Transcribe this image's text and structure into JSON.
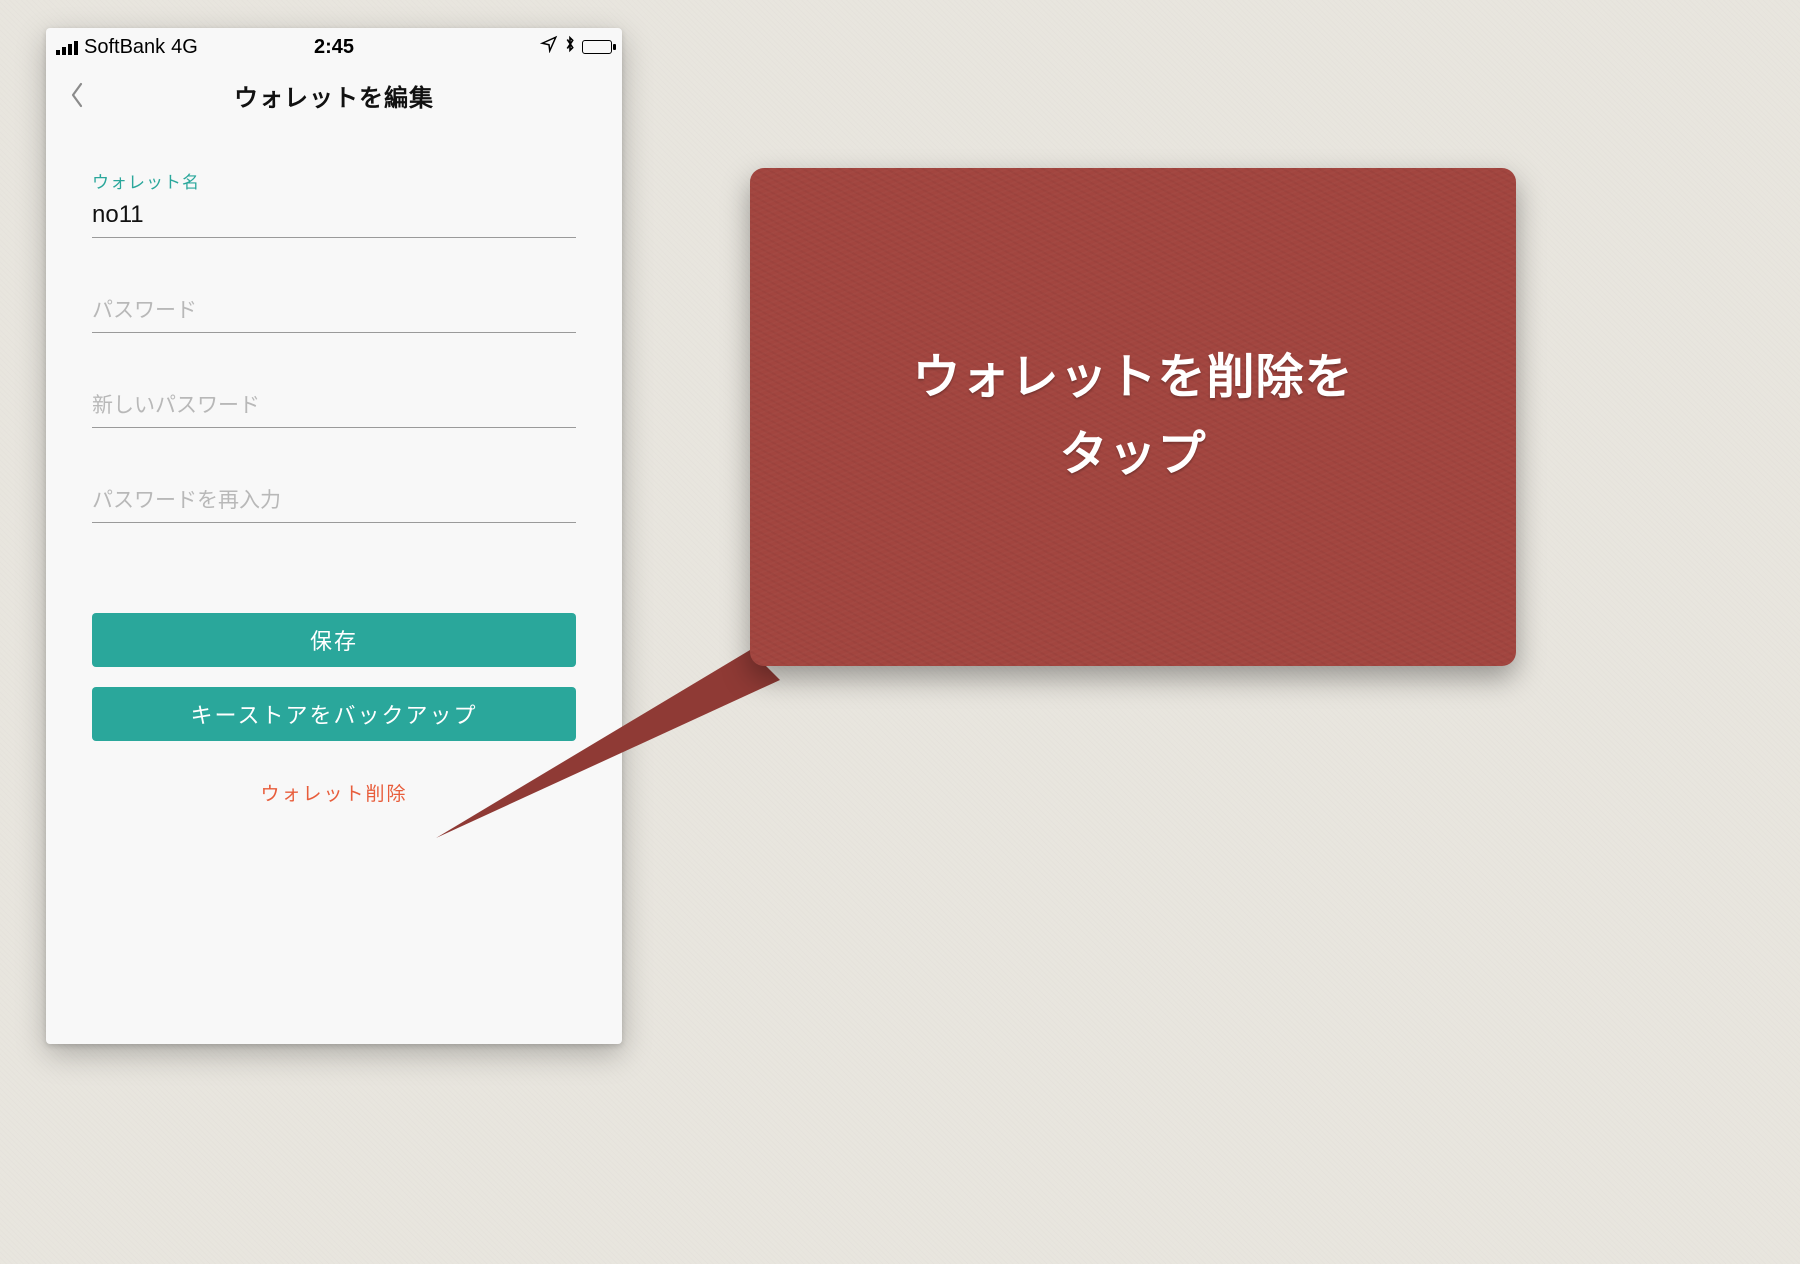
{
  "status": {
    "carrier": "SoftBank",
    "network": "4G",
    "time": "2:45"
  },
  "nav": {
    "title": "ウォレットを編集"
  },
  "fields": {
    "name_label": "ウォレット名",
    "name_value": "no11",
    "password_placeholder": "パスワード",
    "new_password_placeholder": "新しいパスワード",
    "reenter_password_placeholder": "パスワードを再入力"
  },
  "buttons": {
    "save": "保存",
    "backup": "キーストアをバックアップ",
    "delete": "ウォレット削除"
  },
  "callout": {
    "line1": "ウォレットを削除を",
    "line2": "タップ"
  },
  "colors": {
    "accent": "#2aa79b",
    "danger": "#e85d3b",
    "callout": "#a2453f"
  }
}
